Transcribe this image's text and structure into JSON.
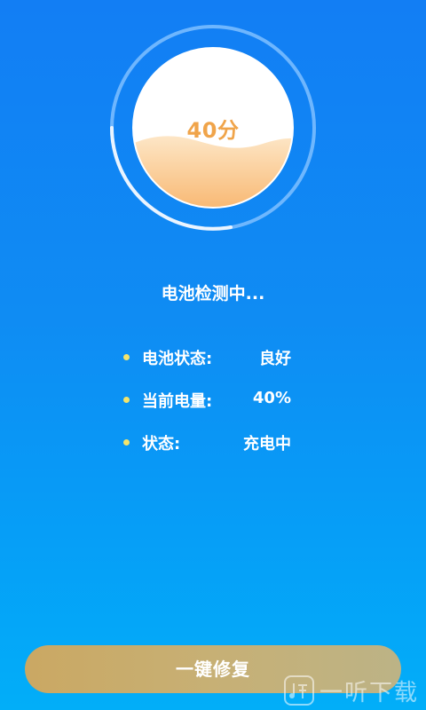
{
  "gauge": {
    "score_text": "40分",
    "level_percent": 40,
    "colors": {
      "ring_track": "#7fc0ff",
      "ring_progress": "#eaf4ff",
      "liquid_top": "#fce3c1",
      "liquid_bottom": "#f7b064",
      "score": "#f0a44a"
    }
  },
  "status_title": "电池检测中...",
  "info": [
    {
      "label": "电池状态:",
      "value": "良好"
    },
    {
      "label": "当前电量:",
      "value": "40%"
    },
    {
      "label": "状态:",
      "value": "充电中"
    }
  ],
  "repair_button": {
    "label": "一键修复"
  },
  "watermark": {
    "text": "一听下载",
    "icon": "music-note-logo-icon"
  }
}
